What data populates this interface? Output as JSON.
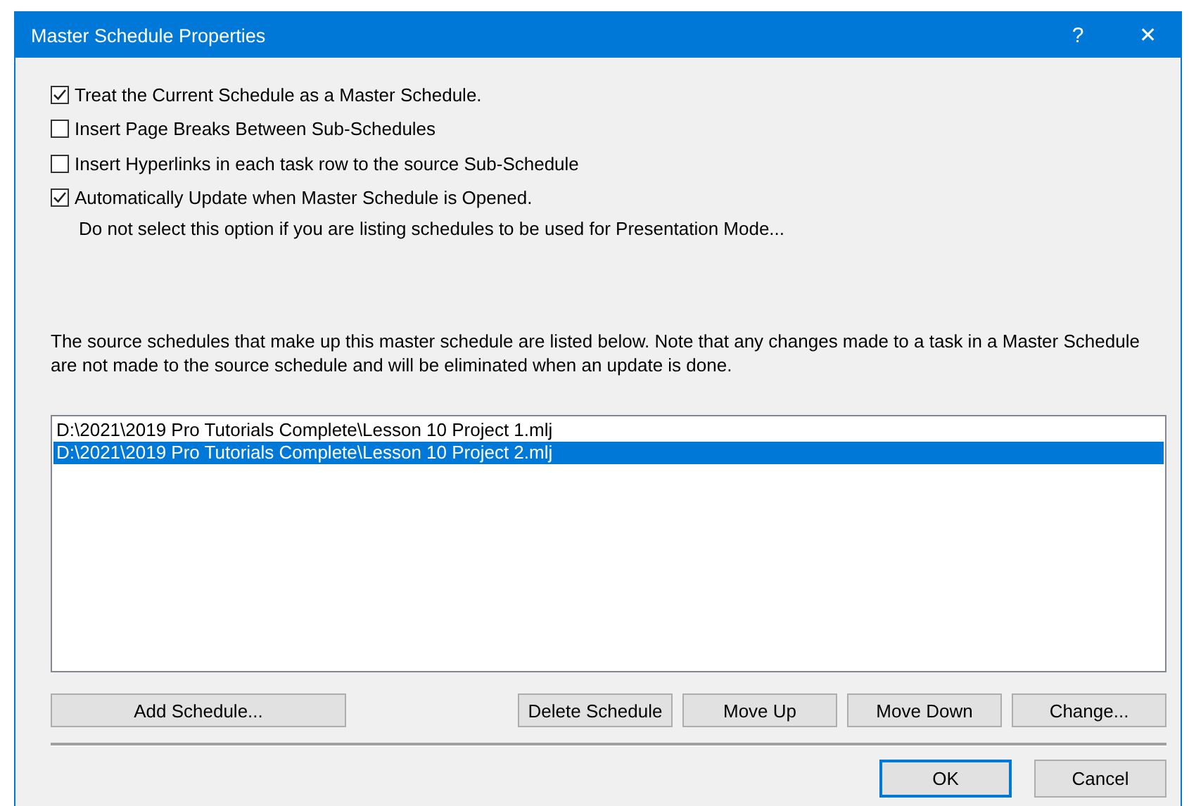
{
  "window": {
    "title": "Master Schedule Properties",
    "help": "?",
    "close": "✕"
  },
  "options": [
    {
      "label": "Treat the Current Schedule as a Master Schedule.",
      "checked": true
    },
    {
      "label": "Insert Page Breaks Between Sub-Schedules",
      "checked": false
    },
    {
      "label": "Insert Hyperlinks in each task row to the source Sub-Schedule",
      "checked": false
    },
    {
      "label": "Automatically Update when Master Schedule is Opened.",
      "checked": true
    }
  ],
  "note": "Do not select this option if you are listing schedules to be used for Presentation Mode...",
  "description": "The source schedules that make up this master schedule are listed below. Note that any changes made to a task in a Master Schedule are not made to the source schedule and will be eliminated when an update is done.",
  "schedules": [
    {
      "path": "D:\\2021\\2019 Pro Tutorials Complete\\Lesson 10 Project 1.mlj",
      "selected": false
    },
    {
      "path": "D:\\2021\\2019 Pro Tutorials Complete\\Lesson 10 Project 2.mlj",
      "selected": true
    }
  ],
  "list_buttons": [
    "Add Schedule...",
    "Delete Schedule",
    "Move Up",
    "Move Down",
    "Change..."
  ],
  "dialog_buttons": [
    {
      "label": "OK",
      "default": true
    },
    {
      "label": "Cancel",
      "default": false
    }
  ]
}
